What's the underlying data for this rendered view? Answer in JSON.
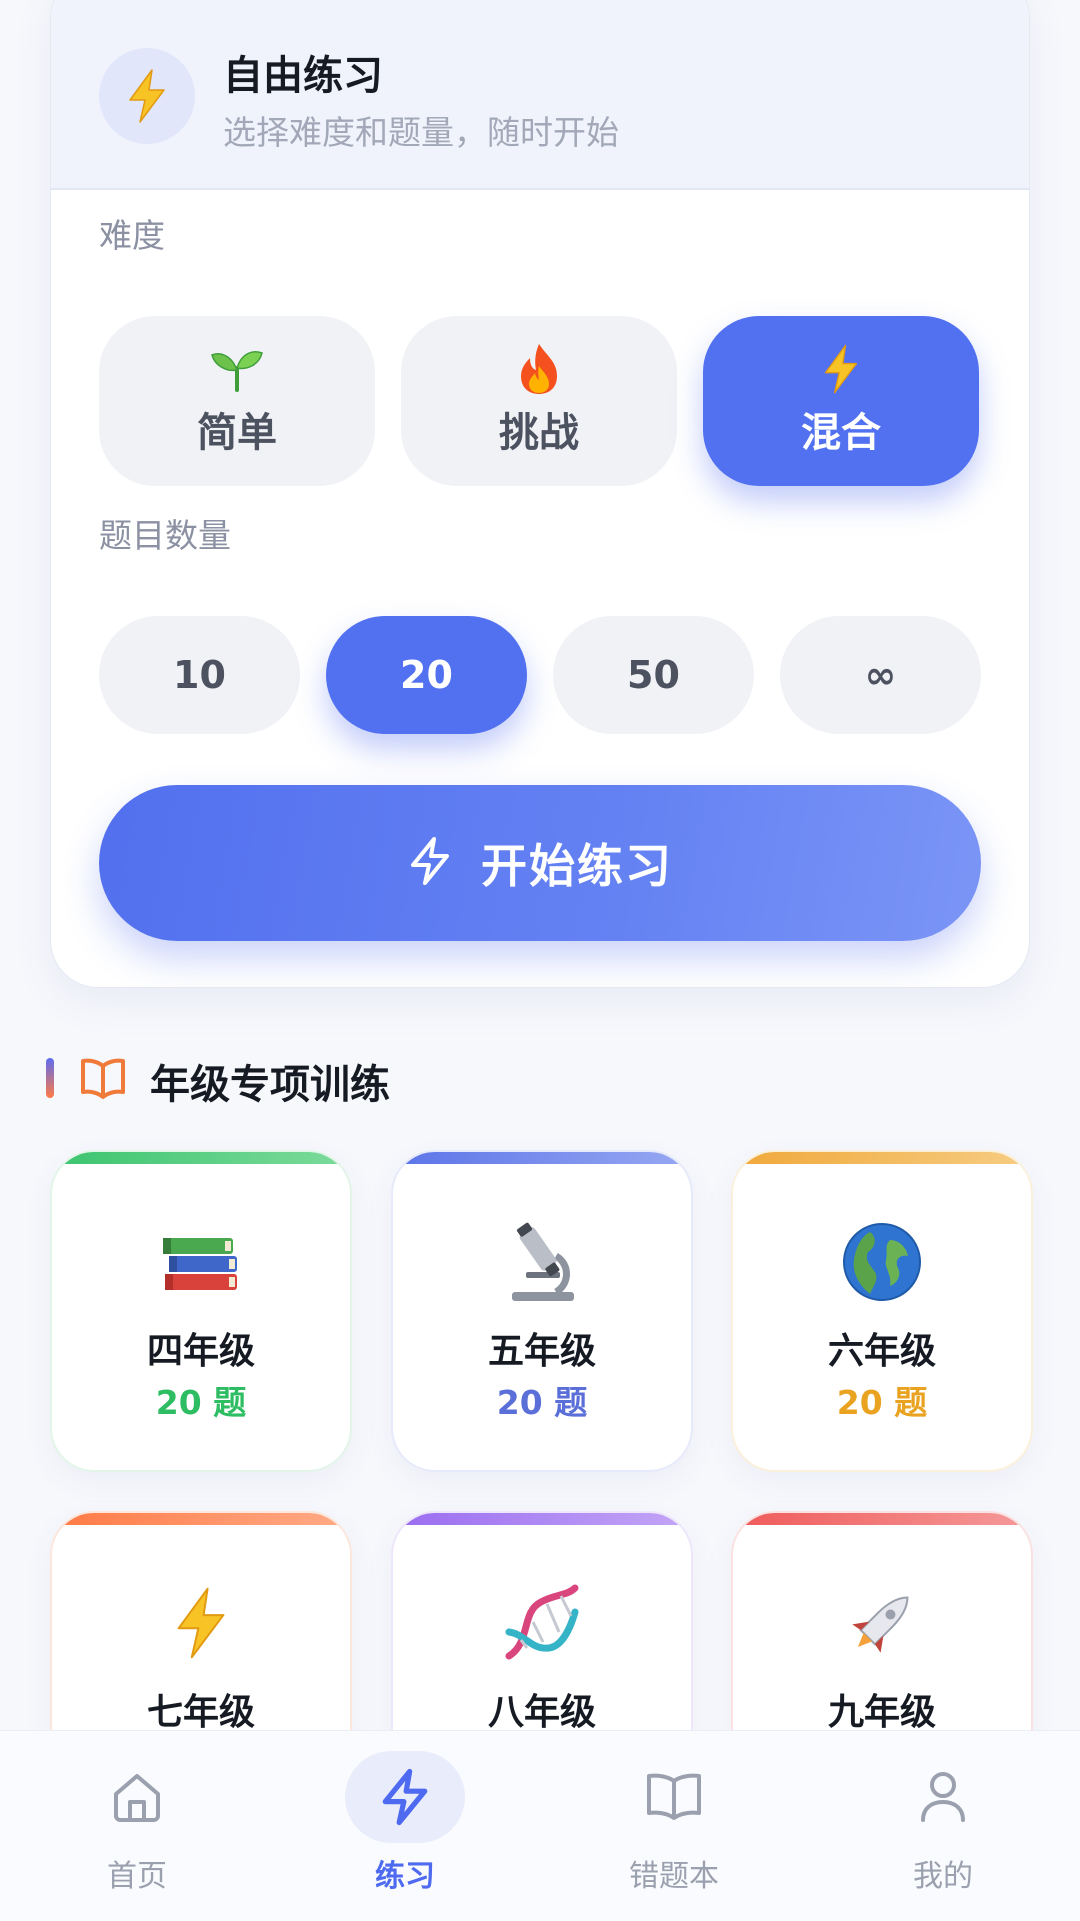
{
  "free_practice": {
    "title": "自由练习",
    "subtitle": "选择难度和题量，随时开始",
    "header_icon": "lightning-icon"
  },
  "difficulty": {
    "label": "难度",
    "options": [
      {
        "label": "简单",
        "icon": "seedling-icon",
        "selected": false
      },
      {
        "label": "挑战",
        "icon": "fire-icon",
        "selected": false
      },
      {
        "label": "混合",
        "icon": "lightning-icon",
        "selected": true
      }
    ]
  },
  "question_count": {
    "label": "题目数量",
    "options": [
      {
        "label": "10",
        "selected": false
      },
      {
        "label": "20",
        "selected": true
      },
      {
        "label": "50",
        "selected": false
      },
      {
        "label": "∞",
        "selected": false
      }
    ]
  },
  "start_button": {
    "label": "开始练习",
    "icon": "lightning-outline-icon"
  },
  "grade_section": {
    "title": "年级专项训练",
    "icon": "open-book-icon",
    "grades": [
      {
        "name": "四年级",
        "count": "20 题",
        "icon": "books-icon",
        "accent": "#3cc46f"
      },
      {
        "name": "五年级",
        "count": "20 题",
        "icon": "microscope-icon",
        "accent": "#5b74e8"
      },
      {
        "name": "六年级",
        "count": "20 题",
        "icon": "globe-icon",
        "accent": "#f0a83a"
      },
      {
        "name": "七年级",
        "icon": "lightning-icon",
        "accent": "#ff7a45"
      },
      {
        "name": "八年级",
        "icon": "dna-icon",
        "accent": "#9a6cf0"
      },
      {
        "name": "九年级",
        "icon": "rocket-icon",
        "accent": "#ef5a5a"
      }
    ]
  },
  "bottom_nav": {
    "items": [
      {
        "label": "首页",
        "icon": "home-icon",
        "active": false
      },
      {
        "label": "练习",
        "icon": "lightning-icon",
        "active": true
      },
      {
        "label": "错题本",
        "icon": "book-icon",
        "active": false
      },
      {
        "label": "我的",
        "icon": "person-icon",
        "active": false
      }
    ]
  },
  "colors": {
    "primary": "#5271f0",
    "count_green": "#2ebd62",
    "count_blue": "#5b6fd8",
    "count_orange": "#e9a321"
  }
}
